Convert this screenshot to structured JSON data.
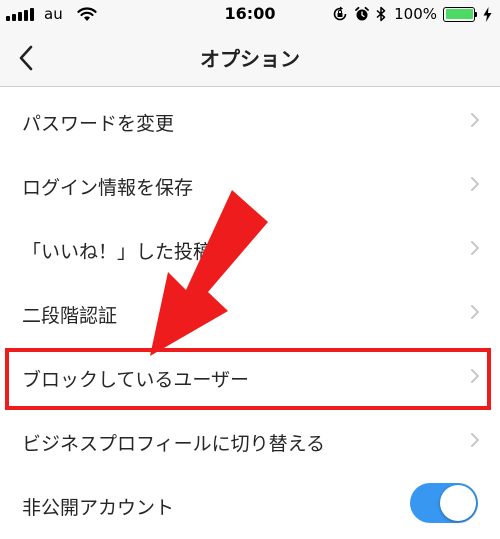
{
  "status_bar": {
    "carrier": "au",
    "time": "16:00",
    "battery_percent": "100%",
    "battery_level": 1.0,
    "icons": [
      "signal-bars-icon",
      "wifi-icon",
      "orientation-lock-icon",
      "alarm-icon",
      "bluetooth-icon",
      "battery-icon",
      "charging-bolt-icon"
    ]
  },
  "nav": {
    "back_icon": "chevron-left-icon",
    "title": "オプション"
  },
  "menu": {
    "items": [
      {
        "label": "パスワードを変更"
      },
      {
        "label": "ログイン情報を保存"
      },
      {
        "label": "「いいね！」した投稿"
      },
      {
        "label": "二段階認証"
      },
      {
        "label": "ブロックしているユーザー"
      },
      {
        "label": "ビジネスプロフィールに切り替える"
      },
      {
        "label": "非公開アカウント",
        "toggle_on": true
      }
    ]
  },
  "colors": {
    "annotation_red": "#ee1c1c",
    "toggle_on": "#3897f0",
    "battery_green": "#4cd964",
    "chevron_gray": "#c7c7cc"
  }
}
